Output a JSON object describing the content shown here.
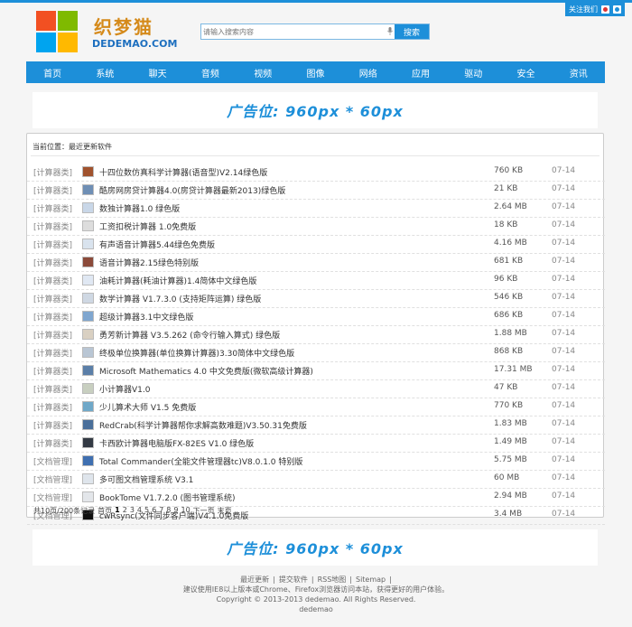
{
  "header": {
    "follow_label": "关注我们",
    "logo_cn": "织梦猫",
    "logo_en": "DEDEMAO.COM",
    "search_placeholder": "请输入搜索内容",
    "search_button": "搜索"
  },
  "nav": [
    "首页",
    "系统",
    "聊天",
    "音频",
    "视频",
    "图像",
    "网络",
    "应用",
    "驱动",
    "安全",
    "资讯"
  ],
  "ad_text": "广告位: 960px * 60px",
  "breadcrumb": "当前位置：最近更新软件",
  "rows": [
    {
      "cat": "[计算器类]",
      "name": "十四位数仿真科学计算器(语音型)V2.14绿色版",
      "size": "760 KB",
      "date": "07-14",
      "icon": "#a0522d"
    },
    {
      "cat": "[计算器类]",
      "name": "酷房网房贷计算器4.0(房贷计算器最新2013)绿色版",
      "size": "21 KB",
      "date": "07-14",
      "icon": "#6f8fb5"
    },
    {
      "cat": "[计算器类]",
      "name": "数独计算器1.0 绿色版",
      "size": "2.64 MB",
      "date": "07-14",
      "icon": "#c9d7e8"
    },
    {
      "cat": "[计算器类]",
      "name": "工资扣税计算器 1.0免费版",
      "size": "18 KB",
      "date": "07-14",
      "icon": "#dddddd"
    },
    {
      "cat": "[计算器类]",
      "name": "有声语音计算器5.44绿色免费版",
      "size": "4.16 MB",
      "date": "07-14",
      "icon": "#d9e3ee"
    },
    {
      "cat": "[计算器类]",
      "name": "语音计算器2.15绿色特别版",
      "size": "681 KB",
      "date": "07-14",
      "icon": "#8b4a3a"
    },
    {
      "cat": "[计算器类]",
      "name": "油耗计算器(耗油计算器)1.4简体中文绿色版",
      "size": "96 KB",
      "date": "07-14",
      "icon": "#e0e8f3"
    },
    {
      "cat": "[计算器类]",
      "name": "数学计算器 V1.7.3.0 (支持矩阵运算) 绿色版",
      "size": "546 KB",
      "date": "07-14",
      "icon": "#cfd8e3"
    },
    {
      "cat": "[计算器类]",
      "name": "超级计算器3.1中文绿色版",
      "size": "686 KB",
      "date": "07-14",
      "icon": "#7fa6cf"
    },
    {
      "cat": "[计算器类]",
      "name": "勇芳新计算器 V3.5.262 (命令行输入算式) 绿色版",
      "size": "1.88 MB",
      "date": "07-14",
      "icon": "#d9d0c2"
    },
    {
      "cat": "[计算器类]",
      "name": "终极单位换算器(单位换算计算器)3.30简体中文绿色版",
      "size": "868 KB",
      "date": "07-14",
      "icon": "#b9c6d4"
    },
    {
      "cat": "[计算器类]",
      "name": "Microsoft Mathematics 4.0 中文免费版(微软高级计算器)",
      "size": "17.31 MB",
      "date": "07-14",
      "icon": "#5b7fa8"
    },
    {
      "cat": "[计算器类]",
      "name": "小计算器V1.0",
      "size": "47 KB",
      "date": "07-14",
      "icon": "#c8cfc0"
    },
    {
      "cat": "[计算器类]",
      "name": "少儿算术大师 V1.5 免费版",
      "size": "770 KB",
      "date": "07-14",
      "icon": "#6fa8c8"
    },
    {
      "cat": "[计算器类]",
      "name": "RedCrab(科学计算器帮你求解高数难题)V3.50.31免费版",
      "size": "1.83 MB",
      "date": "07-14",
      "icon": "#4a6f9a"
    },
    {
      "cat": "[计算器类]",
      "name": "卡西欧计算器电脑版FX-82ES V1.0 绿色版",
      "size": "1.49 MB",
      "date": "07-14",
      "icon": "#333a44"
    },
    {
      "cat": "[文档管理]",
      "name": "Total Commander(全能文件管理器tc)V8.0.1.0 特别版",
      "size": "5.75 MB",
      "date": "07-14",
      "icon": "#3f6fb0"
    },
    {
      "cat": "[文档管理]",
      "name": "多可图文档管理系统 V3.1",
      "size": "60 MB",
      "date": "07-14",
      "icon": "#dfe5ec"
    },
    {
      "cat": "[文档管理]",
      "name": "BookTome V1.7.2.0 (图书管理系统)",
      "size": "2.94 MB",
      "date": "07-14",
      "icon": "#e3e6ea"
    },
    {
      "cat": "[文档管理]",
      "name": "cwRsync(文件同步客户端)V4.1.0免费版",
      "size": "3.4 MB",
      "date": "07-14",
      "icon": "#111111"
    }
  ],
  "pager": {
    "summary": "共10页/200条记录",
    "first": "首页",
    "pages": [
      "1",
      "2",
      "3",
      "4",
      "5",
      "6",
      "7",
      "8",
      "9",
      "10"
    ],
    "next": "下一页",
    "last": "末页"
  },
  "footer": {
    "links": [
      "最近更新",
      "提交软件",
      "RSS地图",
      "Sitemap"
    ],
    "notice": "建议使用IE8以上版本或Chrome、Firefox浏览器访问本站，获得更好的用户体验。",
    "copyright": "Copyright © 2013-2013 dedemao. All Rights Reserved.",
    "site": "dedemao"
  }
}
